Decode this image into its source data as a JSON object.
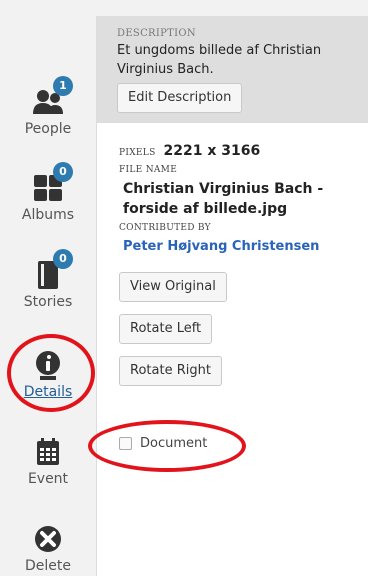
{
  "sidebar": {
    "items": [
      {
        "label": "People",
        "badge": "1",
        "icon": "people-icon"
      },
      {
        "label": "Albums",
        "badge": "0",
        "icon": "albums-icon"
      },
      {
        "label": "Stories",
        "badge": "0",
        "icon": "stories-icon"
      },
      {
        "label": "Details",
        "icon": "info-icon",
        "active": true
      },
      {
        "label": "Event",
        "icon": "calendar-icon"
      },
      {
        "label": "Delete",
        "icon": "close-icon"
      }
    ]
  },
  "panel": {
    "description_label": "DESCRIPTION",
    "description_text": "Et ungdoms billede af Christian Virginius Bach.",
    "edit_button": "Edit Description",
    "pixels_label": "PIXELS",
    "pixels_value": "2221 x 3166",
    "file_name_label": "FILE NAME",
    "file_name": "Christian Virginius Bach - forside af billede.jpg",
    "contributed_label": "CONTRIBUTED BY",
    "contributor": "Peter Højvang Christensen",
    "buttons": [
      "View Original",
      "Rotate Left",
      "Rotate Right"
    ],
    "document_label": "Document",
    "document_checked": false
  },
  "colors": {
    "badge": "#2e7bb0",
    "annotation_ring": "#e1141b",
    "link": "#2a63b8",
    "active_nav": "#245e95"
  }
}
